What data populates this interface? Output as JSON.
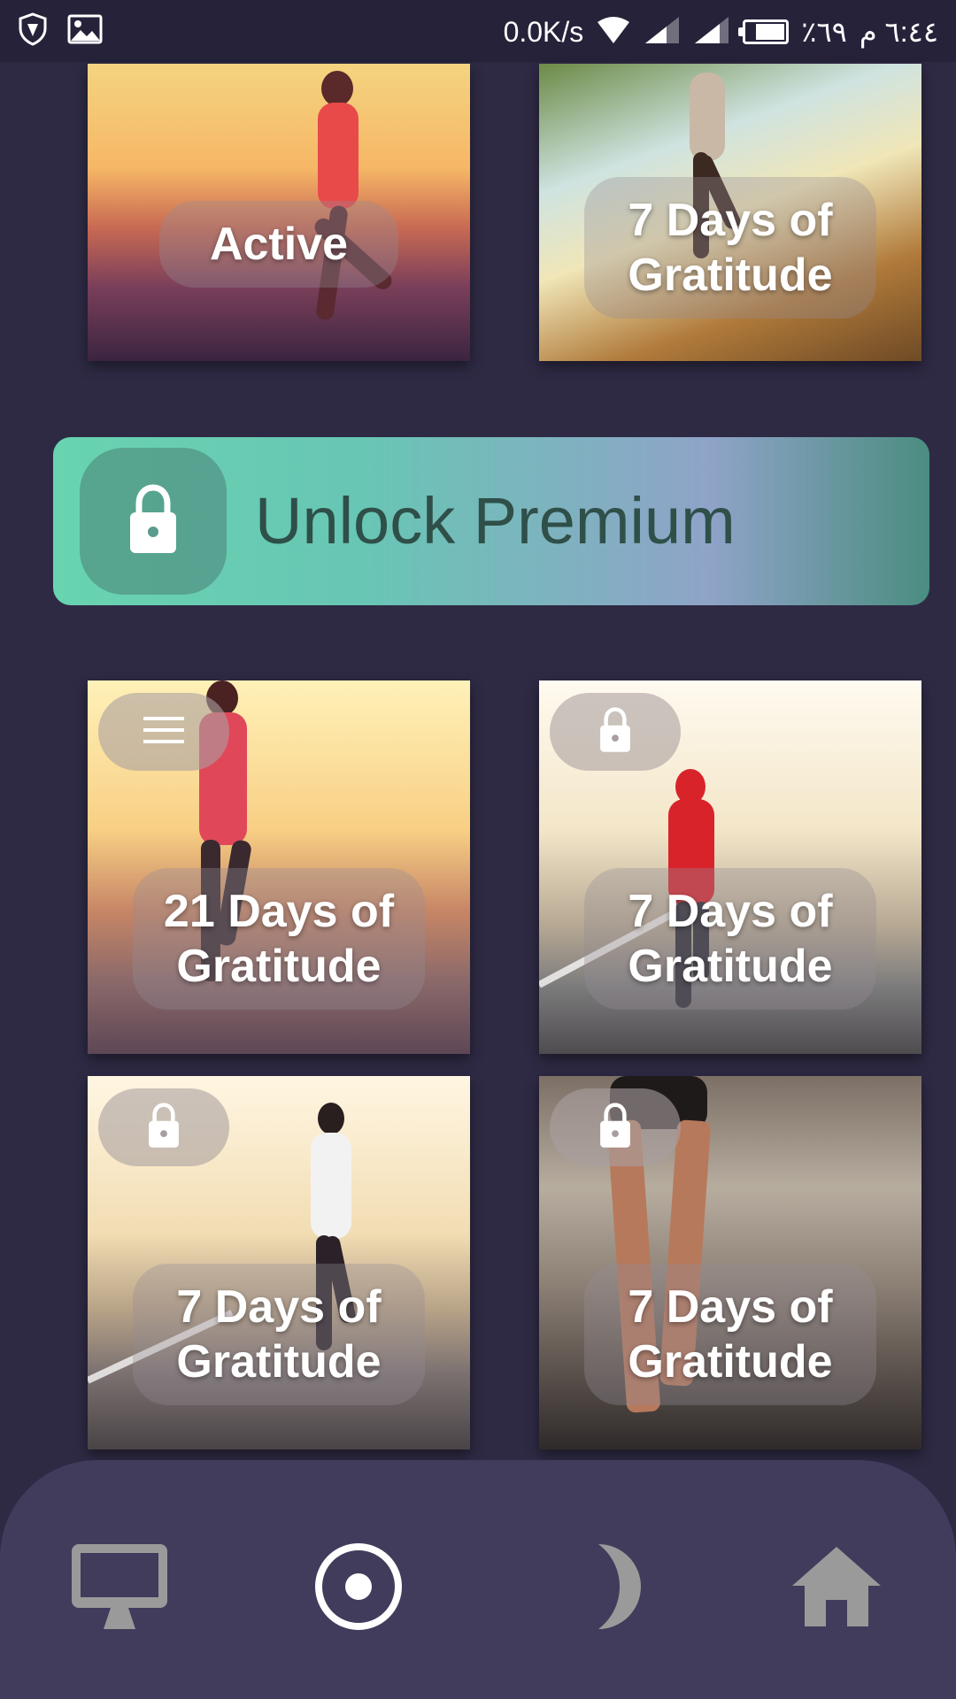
{
  "status_bar": {
    "network_speed": "0.0K/s",
    "battery_percent": "٪٦٩",
    "time": "٦:٤٤ م",
    "icons": [
      "shield-icon",
      "image-icon",
      "wifi-icon",
      "signal-icon",
      "signal-icon",
      "battery-icon"
    ]
  },
  "cards_top": [
    {
      "title": "Active"
    },
    {
      "title": "7 Days of Gratitude"
    }
  ],
  "premium": {
    "label": "Unlock Premium",
    "icon": "lock-icon"
  },
  "cards": [
    {
      "title": "21 Days of Gratitude",
      "badge_icon": "menu-icon"
    },
    {
      "title": "7 Days of Gratitude",
      "badge_icon": "lock-icon"
    },
    {
      "title": "7 Days of Gratitude",
      "badge_icon": "lock-icon"
    },
    {
      "title": "7 Days of Gratitude",
      "badge_icon": "lock-icon"
    }
  ],
  "bottom_nav": {
    "items": [
      {
        "icon": "monitor-icon"
      },
      {
        "icon": "radio-target-icon",
        "active": true
      },
      {
        "icon": "moon-icon"
      },
      {
        "icon": "home-icon"
      }
    ]
  },
  "colors": {
    "background": "#2e2a44",
    "nav_background": "#413b5c",
    "premium_start": "#68d4b0",
    "premium_end": "#8fa3c8",
    "inactive_icon": "#9a9a9a",
    "active_icon": "#ffffff"
  }
}
